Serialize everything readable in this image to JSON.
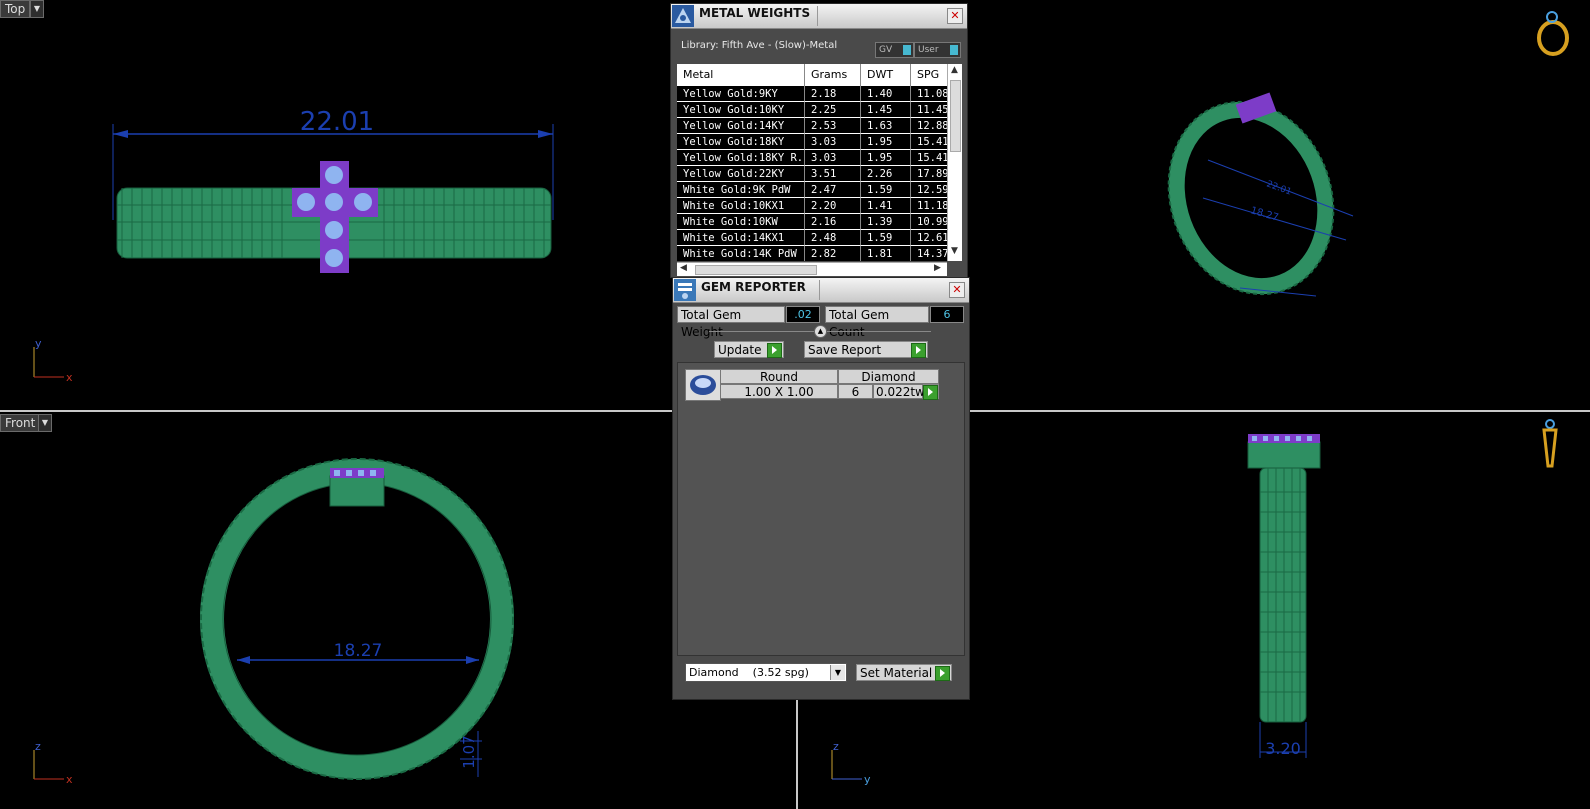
{
  "viewports": {
    "top_label": "Top",
    "front_label": "Front"
  },
  "dimensions": {
    "top_width": "22.01",
    "front_diameter": "18.27",
    "front_thickness": "1.07",
    "side_width": "3.20",
    "persp_diameter": "18.27",
    "persp_small": "22.01"
  },
  "axes": {
    "top": [
      "y",
      "x"
    ],
    "front": [
      "z",
      "x"
    ],
    "side": [
      "z",
      "y"
    ]
  },
  "metal_weights": {
    "title": "METAL WEIGHTS",
    "library": "Library: Fifth Ave - (Slow)-Metal",
    "toggle_gv": "GV",
    "toggle_user": "User",
    "columns": [
      "Metal",
      "Grams",
      "DWT",
      "SPG"
    ],
    "rows": [
      [
        "Yellow Gold:9KY",
        "2.18",
        "1.40",
        "11.08"
      ],
      [
        "Yellow Gold:10KY",
        "2.25",
        "1.45",
        "11.45"
      ],
      [
        "Yellow Gold:14KY",
        "2.53",
        "1.63",
        "12.88"
      ],
      [
        "Yellow Gold:18KY",
        "3.03",
        "1.95",
        "15.41"
      ],
      [
        "Yellow Gold:18KY R...",
        "3.03",
        "1.95",
        "15.41"
      ],
      [
        "Yellow Gold:22KY",
        "3.51",
        "2.26",
        "17.89"
      ],
      [
        "White Gold:9K PdW",
        "2.47",
        "1.59",
        "12.59"
      ],
      [
        "White Gold:10KX1",
        "2.20",
        "1.41",
        "11.18"
      ],
      [
        "White Gold:10KW",
        "2.16",
        "1.39",
        "10.99"
      ],
      [
        "White Gold:14KX1",
        "2.48",
        "1.59",
        "12.61"
      ],
      [
        "White Gold:14K PdW",
        "2.82",
        "1.81",
        "14.37"
      ]
    ]
  },
  "gem_reporter": {
    "title": "GEM REPORTER",
    "total_weight_label": "Total Gem Weight",
    "total_weight_value": ".02",
    "total_count_label": "Total Gem Count",
    "total_count_value": "6",
    "update_label": "Update",
    "save_label": "Save Report",
    "gem": {
      "shape": "Round",
      "material": "Diamond",
      "size": "1.00 X 1.00",
      "count": "6",
      "weight": "0.022tw"
    },
    "material_select": "Diamond    (3.52 spg)",
    "set_material_label": "Set Material"
  }
}
